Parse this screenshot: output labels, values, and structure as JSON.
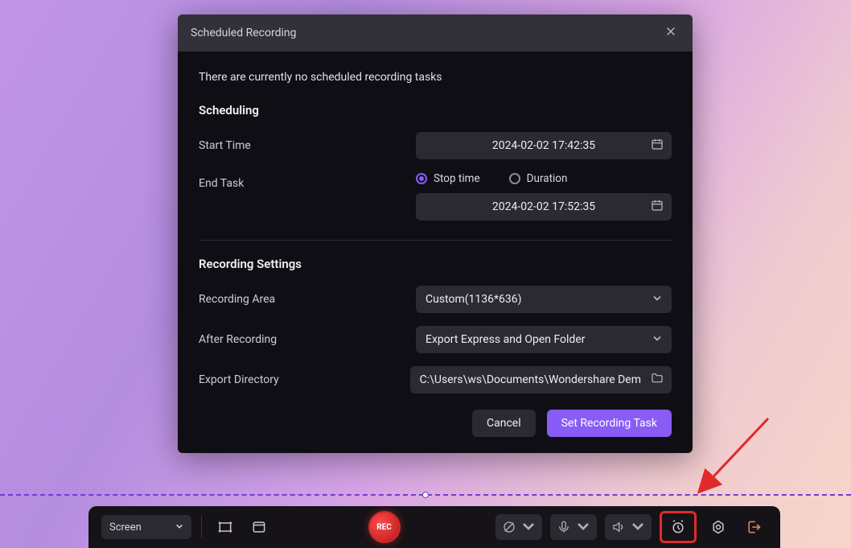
{
  "modal": {
    "title": "Scheduled Recording",
    "empty_message": "There are currently no scheduled recording tasks",
    "scheduling_header": "Scheduling",
    "start_time_label": "Start Time",
    "start_time_value": "2024-02-02 17:42:35",
    "end_task_label": "End Task",
    "radio_stop_time": "Stop time",
    "radio_duration": "Duration",
    "end_time_value": "2024-02-02 17:52:35",
    "recording_settings_header": "Recording Settings",
    "recording_area_label": "Recording Area",
    "recording_area_value": "Custom(1136*636)",
    "after_recording_label": "After Recording",
    "after_recording_value": "Export Express and Open Folder",
    "export_dir_label": "Export Directory",
    "export_dir_value": "C:\\Users\\ws\\Documents\\Wondershare Dem",
    "cancel": "Cancel",
    "set_task": "Set Recording Task"
  },
  "toolbar": {
    "mode": "Screen",
    "rec_label": "REC"
  }
}
